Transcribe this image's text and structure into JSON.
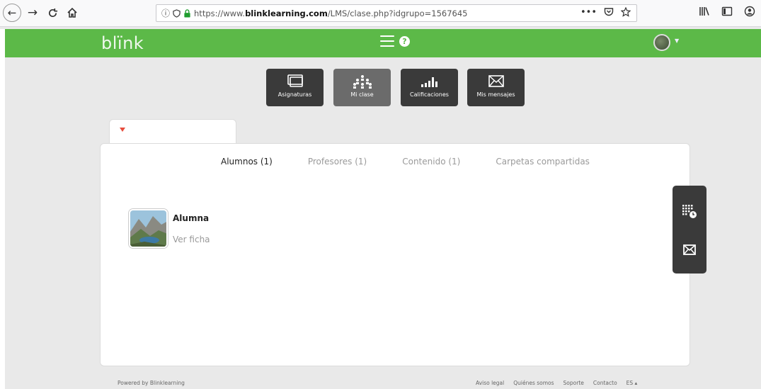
{
  "browser": {
    "back_label": "←",
    "forward_label": "→",
    "reload_label": "C",
    "home_label": "⌂",
    "url_prefix": "https://www.",
    "url_domain": "blinklearning.com",
    "url_path": "/LMS/clase.php?idgrupo=1567645",
    "more_label": "•••"
  },
  "header": {
    "logo": "blïnk",
    "help_label": "?",
    "accent_color": "#5cb948"
  },
  "modules": [
    {
      "label": "Asignaturas",
      "icon": "screens-icon"
    },
    {
      "label": "Mi clase",
      "icon": "class-people-icon"
    },
    {
      "label": "Calificaciones",
      "icon": "bar-chart-icon"
    },
    {
      "label": "Mis mensajes",
      "icon": "envelope-icon"
    }
  ],
  "tabs": [
    {
      "label": "Alumnos (1)",
      "active": true
    },
    {
      "label": "Profesores (1)",
      "active": false
    },
    {
      "label": "Contenido (1)",
      "active": false
    },
    {
      "label": "Carpetas compartidas",
      "active": false
    }
  ],
  "student": {
    "name": "Alumna",
    "link": "Ver ficha"
  },
  "footer": {
    "powered": "Powered by Blinklearning",
    "links": [
      "Aviso legal",
      "Quiénes somos",
      "Soporte",
      "Contacto",
      "ES ▴"
    ]
  }
}
